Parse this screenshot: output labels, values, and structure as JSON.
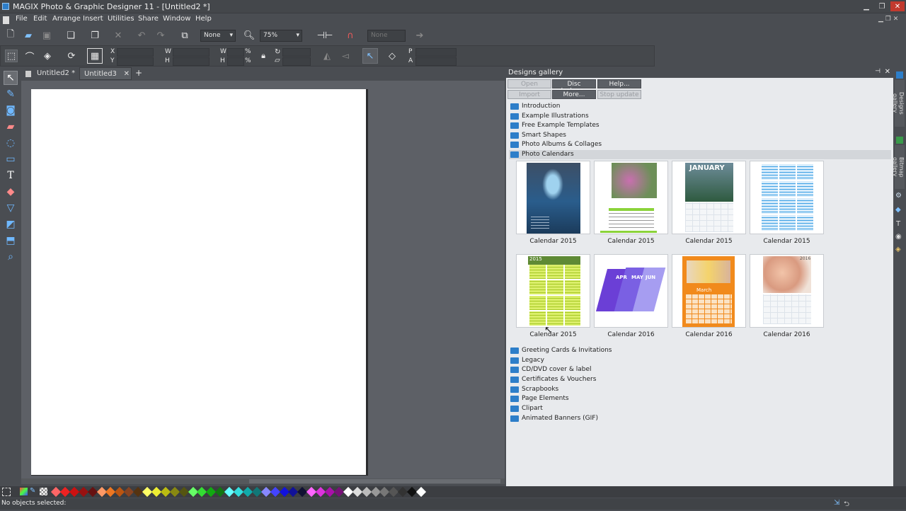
{
  "app": {
    "title": "MAGIX Photo & Graphic Designer 11 - [Untitled2 *]"
  },
  "menu": [
    "File",
    "Edit",
    "Arrange",
    "Insert",
    "Utilities",
    "Share",
    "Window",
    "Help"
  ],
  "toolbar": {
    "feather_value": "None",
    "zoom_value": "75%",
    "font_value": "None"
  },
  "infobar": {
    "x_label": "X",
    "y_label": "Y",
    "w_label": "W",
    "h_label": "H",
    "w2_label": "W",
    "h2_label": "H",
    "pct1": "%",
    "pct2": "%",
    "p_label": "P",
    "a_label": "A"
  },
  "tabs": [
    {
      "label": "Untitled2 *"
    },
    {
      "label": "Untitled3"
    }
  ],
  "gallery": {
    "title": "Designs gallery",
    "buttons": {
      "open": "Open",
      "disc": "Disc designs...",
      "help": "Help...",
      "import": "Import",
      "more": "More...",
      "stop": "Stop update"
    },
    "folders_top": [
      "Introduction",
      "Example Illustrations",
      "Free Example Templates",
      "Smart Shapes",
      "Photo Albums & Collages",
      "Photo Calendars"
    ],
    "thumbs": [
      {
        "caption": "Calendar 2015"
      },
      {
        "caption": "Calendar 2015"
      },
      {
        "caption": "Calendar 2015"
      },
      {
        "caption": "Calendar 2015"
      },
      {
        "caption": "Calendar 2015"
      },
      {
        "caption": "Calendar 2016"
      },
      {
        "caption": "Calendar 2016"
      },
      {
        "caption": "Calendar 2016"
      }
    ],
    "thumb_text": {
      "jan": "JANUARY",
      "apr": "APR",
      "may": "MAY",
      "jun": "JUN",
      "march": "March",
      "year15": "2015",
      "year16": "2016"
    },
    "folders_bottom": [
      "Greeting Cards & Invitations",
      "Legacy",
      "CD/DVD cover & label",
      "Certificates & Vouchers",
      "Scrapbooks",
      "Page Elements",
      "Clipart",
      "Animated Banners (GIF)"
    ]
  },
  "side_tabs": {
    "designs": "Designs gallery",
    "bitmap": "Bitmap gallery"
  },
  "status": {
    "text": "No objects selected:"
  },
  "colors": {
    "accent": "#2d7ec9",
    "tool_blue": "#6fb8ff"
  }
}
